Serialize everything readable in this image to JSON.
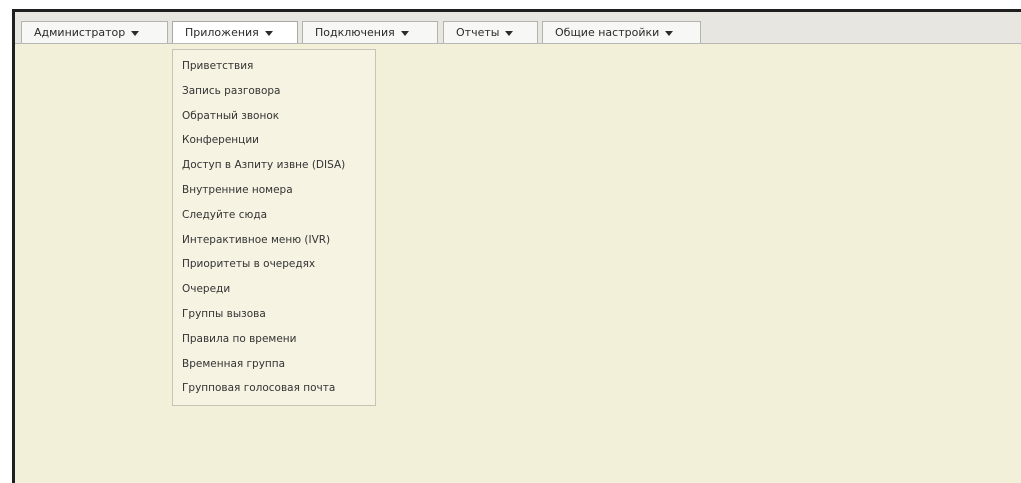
{
  "menubar": {
    "items": [
      {
        "label": "Администратор"
      },
      {
        "label": "Приложения"
      },
      {
        "label": "Подключения"
      },
      {
        "label": "Отчеты"
      },
      {
        "label": "Общие настройки"
      }
    ]
  },
  "dropdown": {
    "parent": "Приложения",
    "items": [
      {
        "label": "Приветствия"
      },
      {
        "label": "Запись разговора"
      },
      {
        "label": "Обратный звонок"
      },
      {
        "label": "Конференции"
      },
      {
        "label": "Доступ в Азпиту извне (DISA)"
      },
      {
        "label": "Внутренние номера"
      },
      {
        "label": "Следуйте сюда"
      },
      {
        "label": "Интерактивное меню (IVR)"
      },
      {
        "label": "Приоритеты в очередях"
      },
      {
        "label": "Очереди"
      },
      {
        "label": "Группы вызова"
      },
      {
        "label": "Правила по времени"
      },
      {
        "label": "Временная группа"
      },
      {
        "label": "Групповая голосовая почта"
      }
    ]
  },
  "icons": {
    "caret": "chevron-down-icon"
  },
  "colors": {
    "page_background": "#f2f0d8",
    "menu_background": "#e7e6e1",
    "dropdown_background": "#f6f3e3",
    "frame_border": "#1f1f1f"
  }
}
